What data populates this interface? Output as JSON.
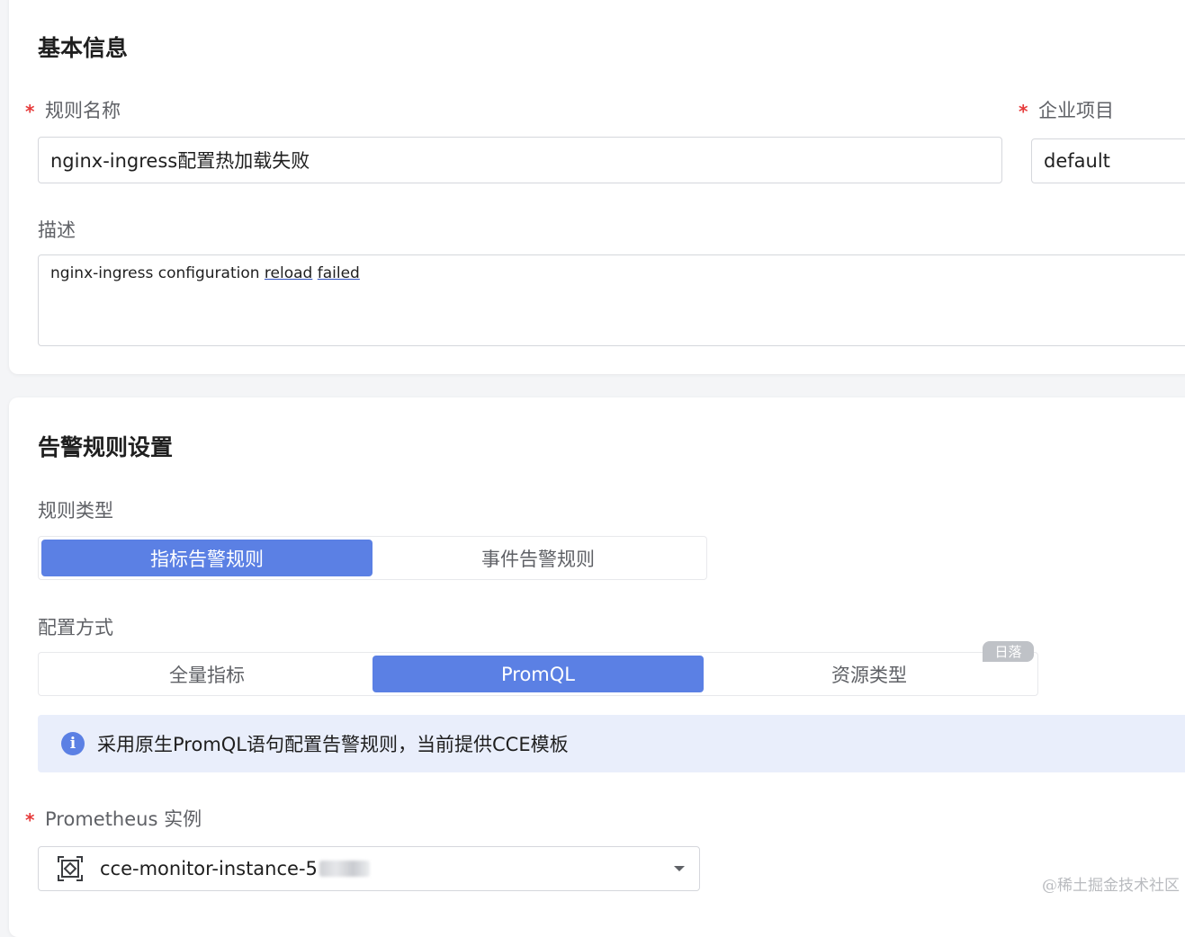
{
  "basic": {
    "title": "基本信息",
    "rule_name_label": "规则名称",
    "rule_name_value": "nginx-ingress配置热加载失败",
    "project_label": "企业项目",
    "project_value": "default",
    "desc_label": "描述",
    "desc_value": {
      "part1": "nginx-ingress configuration ",
      "word1": "reload",
      "space": " ",
      "word2": "failed"
    }
  },
  "alarm": {
    "title": "告警规则设置",
    "rule_type_label": "规则类型",
    "rule_types": [
      "指标告警规则",
      "事件告警规则"
    ],
    "rule_type_selected": "指标告警规则",
    "config_label": "配置方式",
    "config_modes": [
      "全量指标",
      "PromQL",
      "资源类型"
    ],
    "config_selected": "PromQL",
    "badge": "日落",
    "info_text": "采用原生PromQL语句配置告警规则，当前提供CCE模板",
    "prom_label": "Prometheus 实例",
    "prom_value": "cce-monitor-instance-5"
  },
  "required_mark": "*",
  "info_icon_glyph": "i",
  "watermark": "@稀土掘金技术社区",
  "colors": {
    "accent": "#5b80e4",
    "required": "#e63b3b",
    "info_bg": "#e9eefb"
  }
}
